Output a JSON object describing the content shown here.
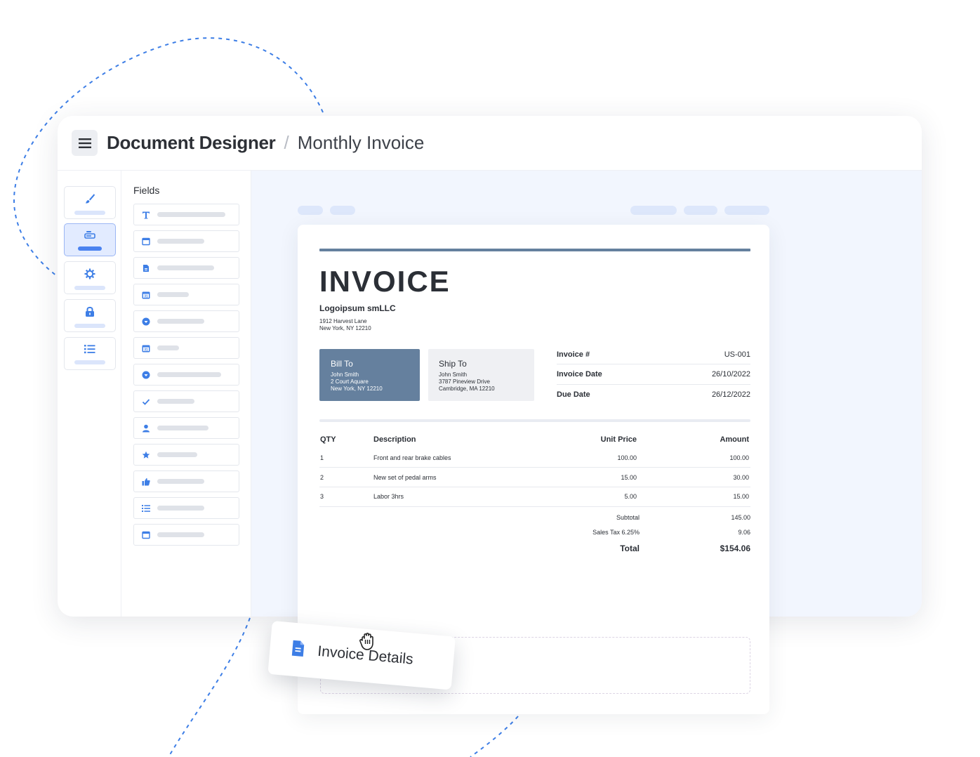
{
  "header": {
    "title": "Document Designer",
    "separator": "/",
    "subtitle": "Monthly Invoice"
  },
  "rail": {
    "items": [
      {
        "icon": "paintbrush-icon",
        "active": false
      },
      {
        "icon": "field-icon",
        "active": true
      },
      {
        "icon": "gear-icon",
        "active": false
      },
      {
        "icon": "lock-icon",
        "active": false
      },
      {
        "icon": "list-icon",
        "active": false
      }
    ]
  },
  "fields": {
    "title": "Fields",
    "items": [
      {
        "icon": "text-icon"
      },
      {
        "icon": "window-icon"
      },
      {
        "icon": "document-icon"
      },
      {
        "icon": "calendar-icon"
      },
      {
        "icon": "dropdown-icon"
      },
      {
        "icon": "calendar-icon"
      },
      {
        "icon": "dropdown-icon"
      },
      {
        "icon": "checkmark-icon"
      },
      {
        "icon": "user-icon"
      },
      {
        "icon": "star-icon"
      },
      {
        "icon": "thumbs-up-icon"
      },
      {
        "icon": "list-icon"
      },
      {
        "icon": "window-icon"
      }
    ]
  },
  "invoice": {
    "title": "INVOICE",
    "company": "Logoipsum smLLC",
    "address_line1": "1912 Harvest Lane",
    "address_line2": "New York, NY 12210",
    "bill_to": {
      "heading": "Bill To",
      "name": "John Smith",
      "line1": "2 Court Aquare",
      "line2": "New York, NY 12210"
    },
    "ship_to": {
      "heading": "Ship To",
      "name": "John Smith",
      "line1": "3787 Pineview Drive",
      "line2": "Cambridge, MA 12210"
    },
    "meta": [
      {
        "label": "Invoice #",
        "value": "US-001"
      },
      {
        "label": "Invoice Date",
        "value": "26/10/2022"
      },
      {
        "label": "Due Date",
        "value": "26/12/2022"
      }
    ],
    "columns": {
      "qty": "QTY",
      "description": "Description",
      "unit_price": "Unit Price",
      "amount": "Amount"
    },
    "rows": [
      {
        "qty": "1",
        "description": "Front and rear brake cables",
        "unit_price": "100.00",
        "amount": "100.00"
      },
      {
        "qty": "2",
        "description": "New set of pedal arms",
        "unit_price": "15.00",
        "amount": "30.00"
      },
      {
        "qty": "3",
        "description": "Labor 3hrs",
        "unit_price": "5.00",
        "amount": "15.00"
      }
    ],
    "totals": {
      "subtotal_label": "Subtotal",
      "subtotal_value": "145.00",
      "tax_label": "Sales Tax 6.25%",
      "tax_value": "9.06",
      "total_label": "Total",
      "total_value": "$154.06"
    }
  },
  "drag_card": {
    "icon": "document-icon",
    "label": "Invoice Details"
  },
  "colors": {
    "accent": "#4a82f0",
    "invoice_slate": "#65809e",
    "canvas_bg": "#f2f6fe",
    "dashed_line": "#3d7ee6"
  }
}
